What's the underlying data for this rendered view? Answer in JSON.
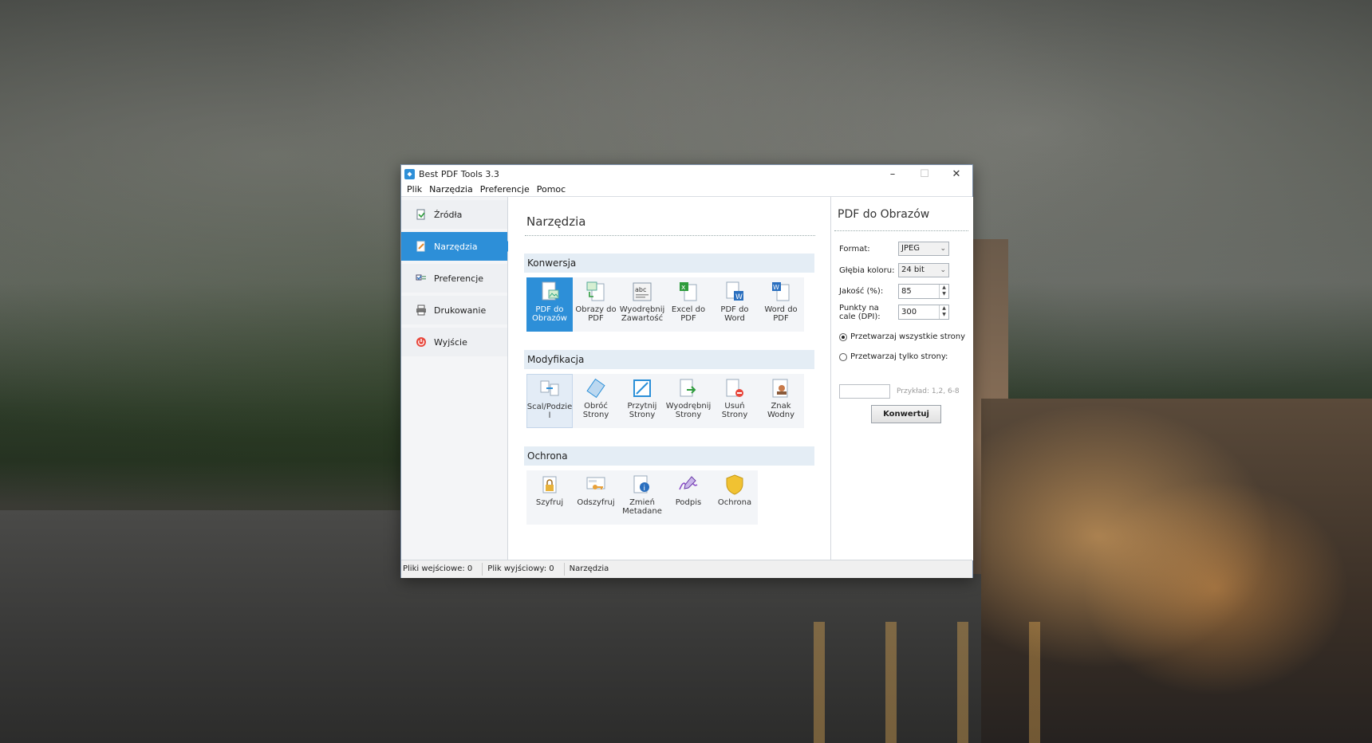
{
  "window": {
    "title": "Best PDF Tools 3.3"
  },
  "menu": [
    "Plik",
    "Narzędzia",
    "Preferencje",
    "Pomoc"
  ],
  "sidebar": {
    "items": [
      {
        "label": "Źródła",
        "icon": "sources-icon",
        "active": false
      },
      {
        "label": "Narzędzia",
        "icon": "tools-icon",
        "active": true
      },
      {
        "label": "Preferencje",
        "icon": "preferences-icon",
        "active": false
      },
      {
        "label": "Drukowanie",
        "icon": "printer-icon",
        "active": false
      },
      {
        "label": "Wyjście",
        "icon": "exit-icon",
        "active": false
      }
    ]
  },
  "main": {
    "title": "Narzędzia",
    "sections": [
      {
        "header": "Konwersja",
        "tools": [
          {
            "label": "PDF do Obrazów",
            "icon": "pdf-to-images-icon",
            "state": "selected"
          },
          {
            "label": "Obrazy do PDF",
            "icon": "images-to-pdf-icon",
            "state": ""
          },
          {
            "label": "Wyodrębnij Zawartość",
            "icon": "extract-content-icon",
            "state": ""
          },
          {
            "label": "Excel do PDF",
            "icon": "excel-to-pdf-icon",
            "state": ""
          },
          {
            "label": "PDF do Word",
            "icon": "pdf-to-word-icon",
            "state": ""
          },
          {
            "label": "Word do PDF",
            "icon": "word-to-pdf-icon",
            "state": ""
          }
        ]
      },
      {
        "header": "Modyfikacja",
        "tools": [
          {
            "label": "Scal/Podzie l",
            "icon": "merge-split-icon",
            "state": "hover"
          },
          {
            "label": "Obróć Strony",
            "icon": "rotate-pages-icon",
            "state": ""
          },
          {
            "label": "Przytnij Strony",
            "icon": "crop-pages-icon",
            "state": ""
          },
          {
            "label": "Wyodrębnij Strony",
            "icon": "extract-pages-icon",
            "state": ""
          },
          {
            "label": "Usuń Strony",
            "icon": "delete-pages-icon",
            "state": ""
          },
          {
            "label": "Znak Wodny",
            "icon": "watermark-icon",
            "state": ""
          }
        ]
      },
      {
        "header": "Ochrona",
        "tools": [
          {
            "label": "Szyfruj",
            "icon": "encrypt-lock-icon",
            "state": ""
          },
          {
            "label": "Odszyfruj",
            "icon": "decrypt-key-icon",
            "state": ""
          },
          {
            "label": "Zmień Metadane",
            "icon": "metadata-info-icon",
            "state": ""
          },
          {
            "label": "Podpis",
            "icon": "signature-pen-icon",
            "state": ""
          },
          {
            "label": "Ochrona",
            "icon": "protection-shield-icon",
            "state": ""
          }
        ]
      }
    ]
  },
  "panel": {
    "title": "PDF do Obrazów",
    "format_label": "Format:",
    "format_value": "JPEG",
    "depth_label": "Głębia koloru:",
    "depth_value": "24 bit",
    "quality_label": "Jakość (%):",
    "quality_value": "85",
    "dpi_label": "Punkty na cale (DPI):",
    "dpi_value": "300",
    "radio_all": "Przetwarzaj wszystkie strony",
    "radio_some": "Przetwarzaj tylko strony:",
    "pages_hint": "Przykład: 1,2, 6-8",
    "convert_label": "Konwertuj"
  },
  "status": {
    "input_files": "Pliki wejściowe: 0",
    "output_files": "Plik wyjściowy: 0",
    "mode": "Narzędzia"
  },
  "colors": {
    "accent": "#2d8fd8",
    "section_bg": "#e4edf5"
  }
}
